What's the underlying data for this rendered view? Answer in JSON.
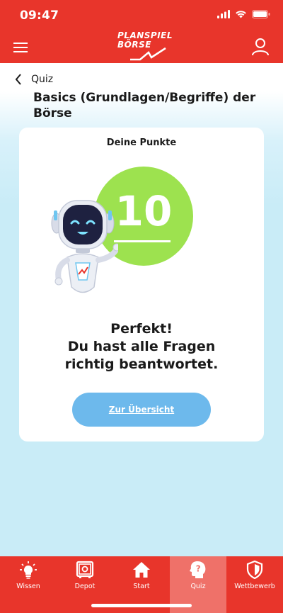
{
  "status_bar": {
    "time": "09:47"
  },
  "header": {
    "logo_line1": "PLANSPIEL",
    "logo_line2": "BÖRSE"
  },
  "breadcrumb": {
    "back_label": "Quiz"
  },
  "page": {
    "title": "Basics (Grundlagen/Begriffe) der Börse"
  },
  "result_card": {
    "points_label": "Deine Punkte",
    "score": "10",
    "headline": "Perfekt!",
    "message": "Du hast alle Fragen richtig beantwortet.",
    "overview_button": "Zur Übersicht"
  },
  "tabbar": {
    "items": [
      {
        "label": "Wissen",
        "icon": "lightbulb-icon"
      },
      {
        "label": "Depot",
        "icon": "safe-icon"
      },
      {
        "label": "Start",
        "icon": "home-icon"
      },
      {
        "label": "Quiz",
        "icon": "question-head-icon",
        "active": true
      },
      {
        "label": "Wettbewerb",
        "icon": "shield-icon"
      }
    ]
  },
  "colors": {
    "brand_red": "#e8352b",
    "active_tab": "#ef7169",
    "score_green": "#9de24f",
    "button_blue": "#6db9ec",
    "background": "#c9ecf7"
  }
}
